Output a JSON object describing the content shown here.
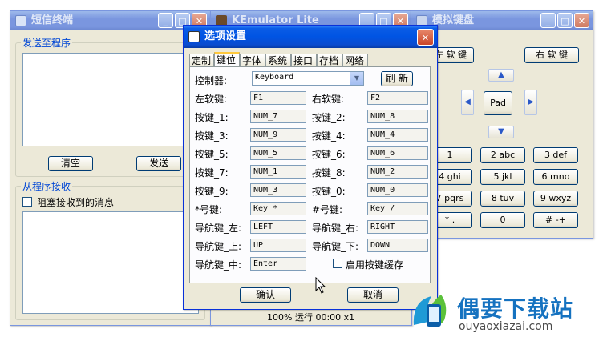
{
  "sms_window": {
    "title": "短信终端",
    "send_group_label": "发送至程序",
    "clear_button": "清空",
    "send_button": "发送",
    "receive_group_label": "从程序接收",
    "block_checkbox_label": "阻塞接收到的消息"
  },
  "emulator_window": {
    "title": "KEmulator Lite",
    "status_text": "100% 运行 00:00 x1"
  },
  "keyboard_window": {
    "title": "模拟键盘",
    "left_soft_key": "左 软 键",
    "right_soft_key": "右 软 键",
    "pad_label": "Pad",
    "keys": [
      "1",
      "2 abc",
      "3 def",
      "4 ghi",
      "5 jkl",
      "6 mno",
      "7 pqrs",
      "8 tuv",
      "9 wxyz",
      "* .",
      "0",
      "# -+"
    ]
  },
  "options_dialog": {
    "title": "选项设置",
    "tabs": [
      "定制",
      "键位",
      "字体",
      "系统",
      "接口",
      "存档",
      "网络"
    ],
    "selected_tab": "键位",
    "controller_label": "控制器:",
    "controller_value": "Keyboard",
    "refresh_button": "刷 新",
    "mappings": [
      {
        "label": "左软键:",
        "value": "F1"
      },
      {
        "label": "右软键:",
        "value": "F2"
      },
      {
        "label": "按键_1:",
        "value": "NUM_7"
      },
      {
        "label": "按键_2:",
        "value": "NUM_8"
      },
      {
        "label": "按键_3:",
        "value": "NUM_9"
      },
      {
        "label": "按键_4:",
        "value": "NUM_4"
      },
      {
        "label": "按键_5:",
        "value": "NUM_5"
      },
      {
        "label": "按键_6:",
        "value": "NUM_6"
      },
      {
        "label": "按键_7:",
        "value": "NUM_1"
      },
      {
        "label": "按键_8:",
        "value": "NUM_2"
      },
      {
        "label": "按键_9:",
        "value": "NUM_3"
      },
      {
        "label": "按键_0:",
        "value": "NUM_0"
      },
      {
        "label": "*号键:",
        "value": "Key *"
      },
      {
        "label": "#号键:",
        "value": "Key /"
      },
      {
        "label": "导航键_左:",
        "value": "LEFT"
      },
      {
        "label": "导航键_右:",
        "value": "RIGHT"
      },
      {
        "label": "导航键_上:",
        "value": "UP"
      },
      {
        "label": "导航键_下:",
        "value": "DOWN"
      },
      {
        "label": "导航键_中:",
        "value": "Enter"
      }
    ],
    "cache_checkbox_label": "启用按键缓存",
    "ok_button": "确认",
    "cancel_button": "取消"
  },
  "watermark": {
    "brand": "偶要下载站",
    "url": "ouyaoxiazai.com"
  },
  "colors": {
    "active_title": "#0054e3",
    "inactive_title": "#7a96df",
    "window_bg": "#ece9d8",
    "group_label": "#0046d5"
  }
}
